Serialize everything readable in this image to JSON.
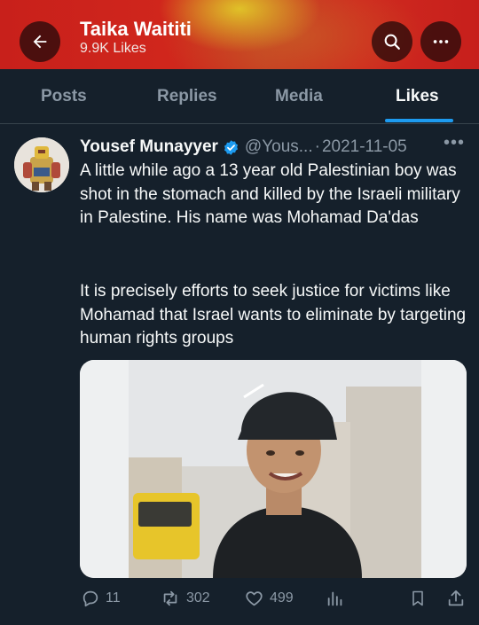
{
  "header": {
    "title": "Taika Waititi",
    "subtitle": "9.9K Likes",
    "back_icon": "arrow-left-icon",
    "search_icon": "search-icon",
    "more_icon": "more-horizontal-icon"
  },
  "tabs": [
    {
      "label": "Posts",
      "selected": false
    },
    {
      "label": "Replies",
      "selected": false
    },
    {
      "label": "Media",
      "selected": false
    },
    {
      "label": "Likes",
      "selected": true
    }
  ],
  "post": {
    "author": "Yousef Munayyer",
    "verified": true,
    "handle": "@Yous...",
    "separator": "·",
    "date": "2021-11-05",
    "more": "•••",
    "text_paragraph_1": "A little while ago a 13 year old Palestinian boy was shot in the stomach and killed by the Israeli military in Palestine. His name was Mohamad Da'das",
    "text_paragraph_2": "It is precisely efforts to seek justice for victims like Mohamad that Israel wants to eliminate by targeting human rights groups",
    "actions": {
      "replies": "11",
      "reposts": "302",
      "likes": "499"
    }
  },
  "colors": {
    "background": "#15202b",
    "accent": "#1d9bf0",
    "muted": "#8b98a5",
    "header_red": "#c8201b"
  }
}
